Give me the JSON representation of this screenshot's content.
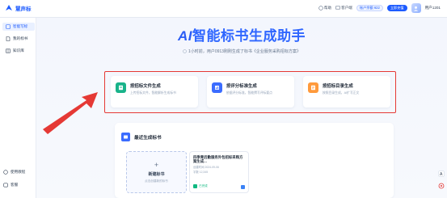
{
  "brand": {
    "name": "慧声标"
  },
  "topbar": {
    "help_label": "帮助",
    "customer_label": "客户端",
    "account_text": "账户余额 ¥22",
    "recharge_label": "立即充值",
    "user_name": "用户1201"
  },
  "sidebar": {
    "items": [
      {
        "label": "智能写标"
      },
      {
        "label": "我的标书"
      },
      {
        "label": "知识库"
      }
    ],
    "bottom": [
      {
        "label": "使用教程"
      },
      {
        "label": "客服"
      }
    ]
  },
  "hero": {
    "title_ai": "AI",
    "title_rest": "智能标书生成助手",
    "subtitle": "1小时前，用户0913刚刚生成了标书《企业服务采购招标方案》"
  },
  "cards": [
    {
      "title": "按招标文件生成",
      "desc": "上传招标文件，智能解析生成标书",
      "color": "#19b38a",
      "icon": "document-icon"
    },
    {
      "title": "按评分标准生成",
      "desc": "依据评分标准，智能撰写评标要点",
      "color": "#3b6cff",
      "icon": "scale-icon"
    },
    {
      "title": "按招标目录生成",
      "desc": "按照目录生成，AI扩写正文",
      "color": "#ff9a3c",
      "icon": "list-icon"
    }
  ],
  "recent": {
    "title": "最近生成标书",
    "new_label": "新建标书",
    "new_hint": "点击创建新的标书",
    "doc": {
      "title": "四季青后勤服务外包招标采购方案生成...",
      "meta1": "创建时间 2024-09-06",
      "meta2": "字数 12,345",
      "status": "已完成"
    }
  },
  "colors": {
    "accent": "#1d5bff",
    "annotation": "#e53935"
  }
}
